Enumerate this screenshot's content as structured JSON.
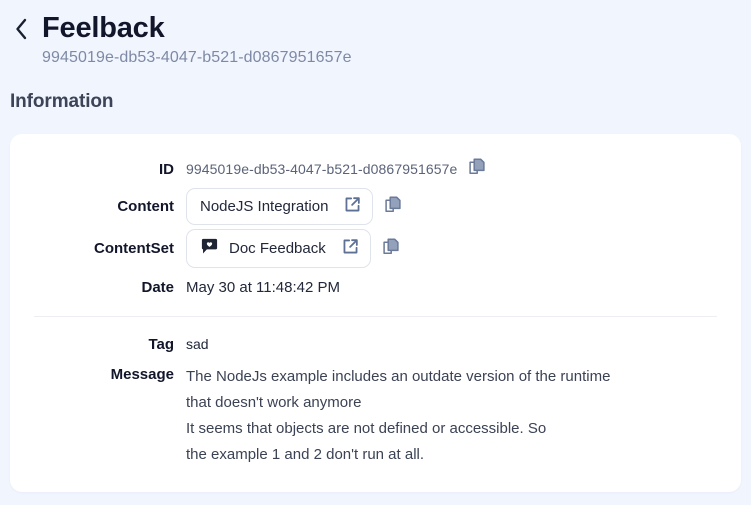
{
  "header": {
    "back_icon": "chevron-left-icon",
    "title": "Feelback",
    "subtitle": "9945019e-db53-4047-b521-d0867951657e"
  },
  "section": {
    "heading": "Information"
  },
  "info": {
    "id": {
      "label": "ID",
      "value": "9945019e-db53-4047-b521-d0867951657e",
      "copy_icon": "copy-icon"
    },
    "content": {
      "label": "Content",
      "value": "NodeJS Integration",
      "open_icon": "external-link-icon",
      "copy_icon": "copy-icon"
    },
    "contentset": {
      "label": "ContentSet",
      "value": "Doc Feedback",
      "badge_icon": "speech-bubble-heart-icon",
      "open_icon": "external-link-icon",
      "copy_icon": "copy-icon"
    },
    "date": {
      "label": "Date",
      "value": "May 30 at 11:48:42 PM"
    },
    "tag": {
      "label": "Tag",
      "value": "sad"
    },
    "message": {
      "label": "Message",
      "value": "The NodeJs example includes an outdate version of the runtime\nthat doesn't work anymore\nIt seems that objects are not defined or accessible. So\nthe example 1 and 2 don't run at all."
    }
  },
  "colors": {
    "background": "#f1f5fe",
    "card": "#ffffff",
    "title": "#12162a",
    "subtitle": "#7e8aa5",
    "icon_slate": "#64748b",
    "badge_dark": "#1e2433",
    "divider": "#eceef3"
  }
}
